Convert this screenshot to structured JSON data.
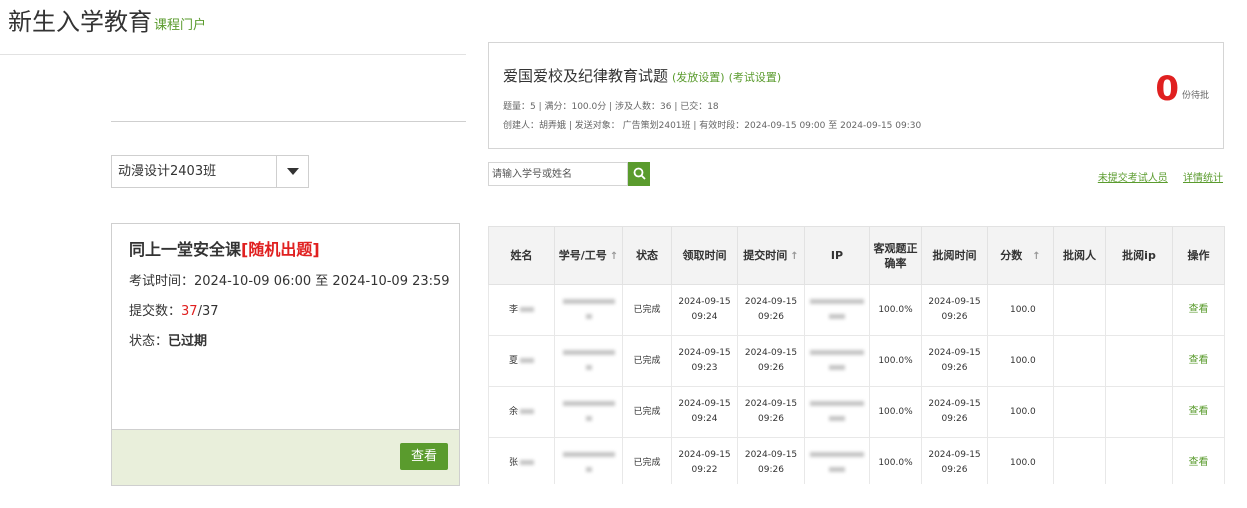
{
  "header": {
    "title": "新生入学教育",
    "subtitle": "课程门户"
  },
  "class_select": {
    "value": "动漫设计2403班"
  },
  "exam_card": {
    "title": "同上一堂安全课",
    "tag": "[随机出题]",
    "time_label": "考试时间：",
    "time_value": "2024-10-09 06:00 至 2024-10-09 23:59",
    "submit_label": "提交数：",
    "submit_count": "37",
    "submit_total": "/37",
    "status_label": "状态：",
    "status_value": "已过期",
    "view_label": "查看"
  },
  "summary": {
    "title": "爱国爱校及纪律教育试题",
    "link_release": "(发放设置)",
    "link_exam": "(考试设置)",
    "meta1": "题量：5 |  满分：100.0分 |  涉及人数：36 | 已交：18",
    "meta2": "创建人：胡弄娥 | 发送对象：  广告策划2401班  |  有效时段：2024-09-15 09:00 至 2024-09-15 09:30",
    "pending_count": "0",
    "pending_label": "份待批"
  },
  "search": {
    "placeholder": "请输入学号或姓名"
  },
  "links": {
    "not_submitted": "未提交考试人员",
    "details": "详情统计"
  },
  "table": {
    "headers": [
      "姓名",
      "学号/工号",
      "状态",
      "领取时间",
      "提交时间",
      "IP",
      "客观题正确率",
      "批阅时间",
      "分数",
      "批阅人",
      "批阅ip",
      "操作"
    ],
    "sort_icon": "↑",
    "rows": [
      {
        "name": "李",
        "status": "已完成",
        "receive_date": "2024-09-15",
        "receive_time": "09:24",
        "submit_date": "2024-09-15",
        "submit_time": "09:26",
        "accuracy": "100.0%",
        "review_date": "2024-09-15",
        "review_time": "09:26",
        "score": "100.0",
        "action": "查看"
      },
      {
        "name": "夏",
        "status": "已完成",
        "receive_date": "2024-09-15",
        "receive_time": "09:23",
        "submit_date": "2024-09-15",
        "submit_time": "09:26",
        "accuracy": "100.0%",
        "review_date": "2024-09-15",
        "review_time": "09:26",
        "score": "100.0",
        "action": "查看"
      },
      {
        "name": "余",
        "status": "已完成",
        "receive_date": "2024-09-15",
        "receive_time": "09:24",
        "submit_date": "2024-09-15",
        "submit_time": "09:26",
        "accuracy": "100.0%",
        "review_date": "2024-09-15",
        "review_time": "09:26",
        "score": "100.0",
        "action": "查看"
      },
      {
        "name": "张",
        "status": "已完成",
        "receive_date": "2024-09-15",
        "receive_time": "09:22",
        "submit_date": "2024-09-15",
        "submit_time": "09:26",
        "accuracy": "100.0%",
        "review_date": "2024-09-15",
        "review_time": "09:26",
        "score": "100.0",
        "action": "查看"
      }
    ]
  },
  "colors": {
    "accent": "#5a9b2d",
    "danger": "#e02020",
    "footer_bg": "#e9efdb"
  },
  "icons": {
    "search": "search-icon",
    "dropdown": "triangle-down-icon",
    "sort": "arrow-up-icon"
  }
}
